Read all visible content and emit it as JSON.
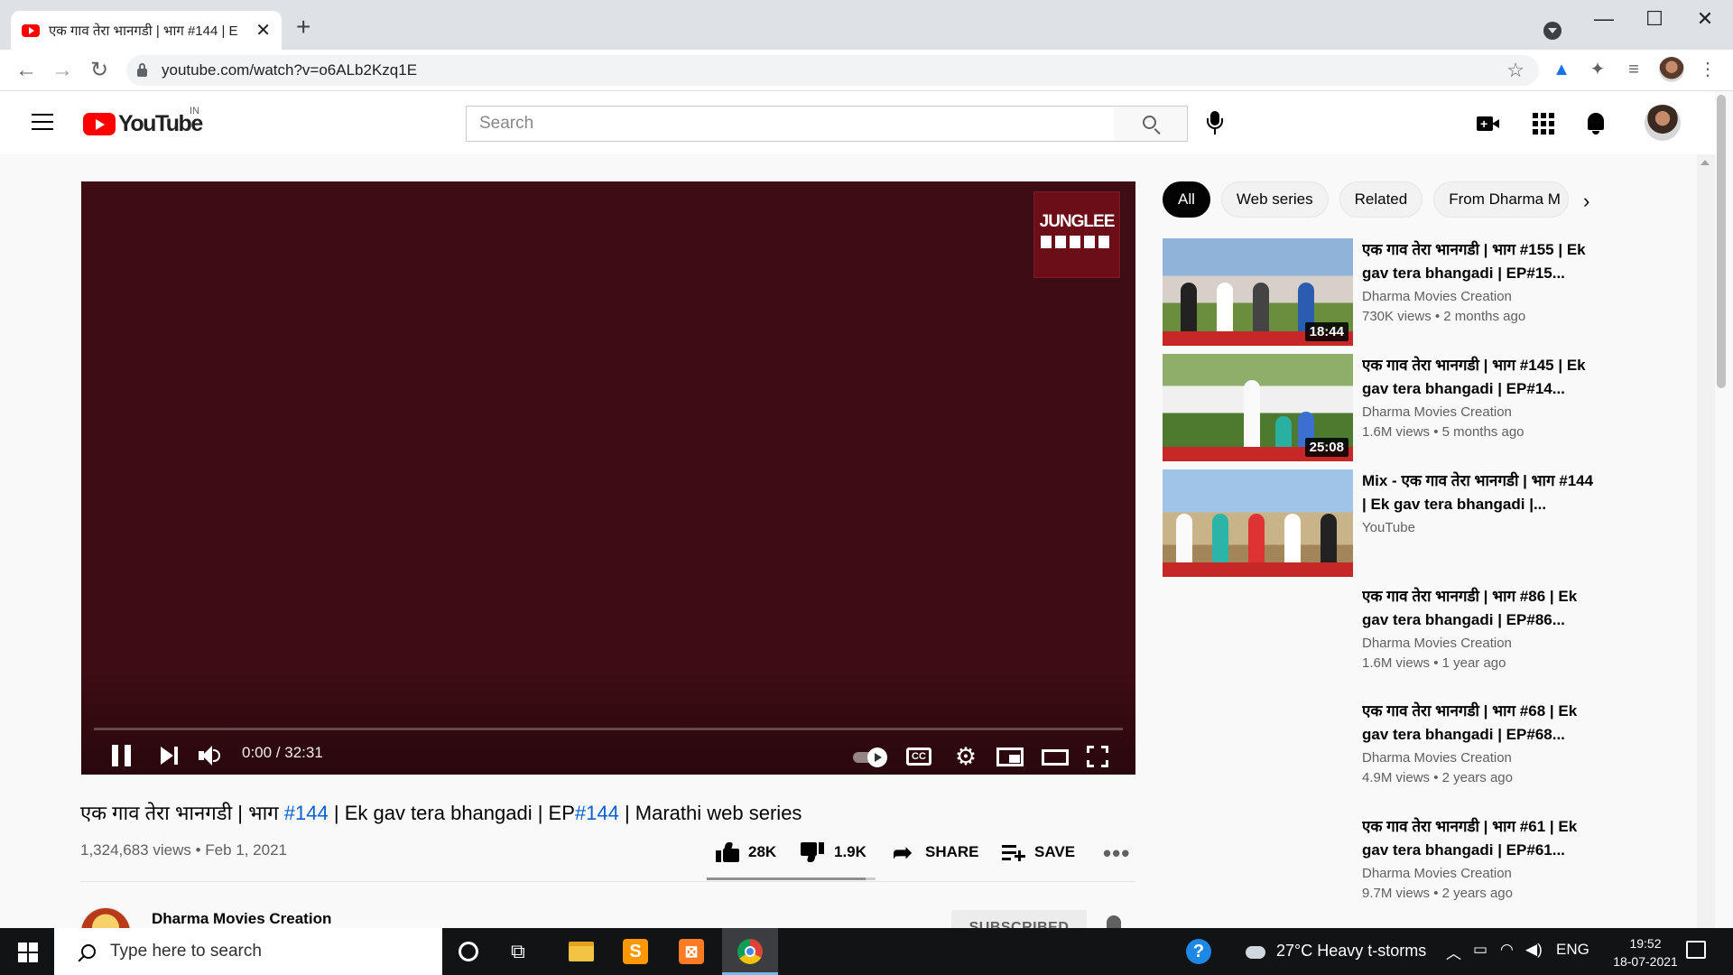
{
  "browser": {
    "tab_title": "एक गाव तेरा भानगडी | भाग #144 | E",
    "url": "youtube.com/watch?v=o6ALb2Kzq1E",
    "new_tab": "+",
    "tab_close": "✕",
    "win_minimize": "—",
    "win_maximize": "☐",
    "win_close": "✕",
    "back": "←",
    "forward": "→",
    "reload": "↻",
    "bookmark": "☆",
    "menu": "⋮"
  },
  "masthead": {
    "logo_text": "YouTube",
    "country_code": "IN",
    "search_placeholder": "Search"
  },
  "player": {
    "watermark_text": "JUNGLEE",
    "time": "0:00 / 32:31",
    "cc_label": "CC",
    "settings_glyph": "⚙",
    "progress_fraction": 0
  },
  "video": {
    "title_part1": "एक गाव तेरा भानगडी | भाग ",
    "title_tag1": "#144",
    "title_part2": " | Ek gav tera bhangadi | EP",
    "title_tag2": "#144",
    "title_part3": " | Marathi web series",
    "meta": "1,324,683 views • Feb 1, 2021",
    "likes": "28K",
    "dislikes": "1.9K",
    "share_label": "SHARE",
    "save_label": "SAVE",
    "more": "•••",
    "like_ratio": 0.94
  },
  "channel": {
    "name": "Dharma Movies Creation",
    "subscribe_label": "SUBSCRIBED"
  },
  "sidebar": {
    "chips": [
      "All",
      "Web series",
      "Related",
      "From Dharma M"
    ],
    "chip_next": "›",
    "recommendations": [
      {
        "title": "एक गाव तेरा भानगडी | भाग #155 | Ek gav tera bhangadi | EP#15...",
        "channel": "Dharma Movies Creation",
        "meta": "730K views • 2 months ago",
        "duration": "18:44"
      },
      {
        "title": "एक गाव तेरा भानगडी | भाग #145 | Ek gav tera bhangadi | EP#14...",
        "channel": "Dharma Movies Creation",
        "meta": "1.6M views • 5 months ago",
        "duration": "25:08"
      },
      {
        "title": "Mix - एक गाव तेरा भानगडी | भाग #144 | Ek gav tera bhangadi |...",
        "channel": "YouTube",
        "meta": "",
        "duration": ""
      },
      {
        "title": "एक गाव तेरा भानगडी | भाग #86 | Ek gav tera bhangadi | EP#86...",
        "channel": "Dharma Movies Creation",
        "meta": "1.6M views • 1 year ago",
        "duration": ""
      },
      {
        "title": "एक गाव तेरा भानगडी | भाग #68 | Ek gav tera bhangadi | EP#68...",
        "channel": "Dharma Movies Creation",
        "meta": "4.9M views • 2 years ago",
        "duration": ""
      },
      {
        "title": "एक गाव तेरा भानगडी | भाग #61 | Ek gav tera bhangadi | EP#61...",
        "channel": "Dharma Movies Creation",
        "meta": "9.7M views • 2 years ago",
        "duration": ""
      }
    ]
  },
  "taskbar": {
    "search_placeholder": "Type here to search",
    "weather": "27°C  Heavy t-storms",
    "help_glyph": "?",
    "tray_chevron": "︿",
    "language": "ENG",
    "time": "19:52",
    "date": "18-07-2021",
    "sublime_glyph": "S",
    "xampp_glyph": "⊠",
    "taskview_glyph": "⧉"
  },
  "colors": {
    "brand_red": "#ff0000",
    "link_blue": "#065fd4",
    "player_bg": "#3e0c14",
    "taskbar_bg": "#111315"
  }
}
